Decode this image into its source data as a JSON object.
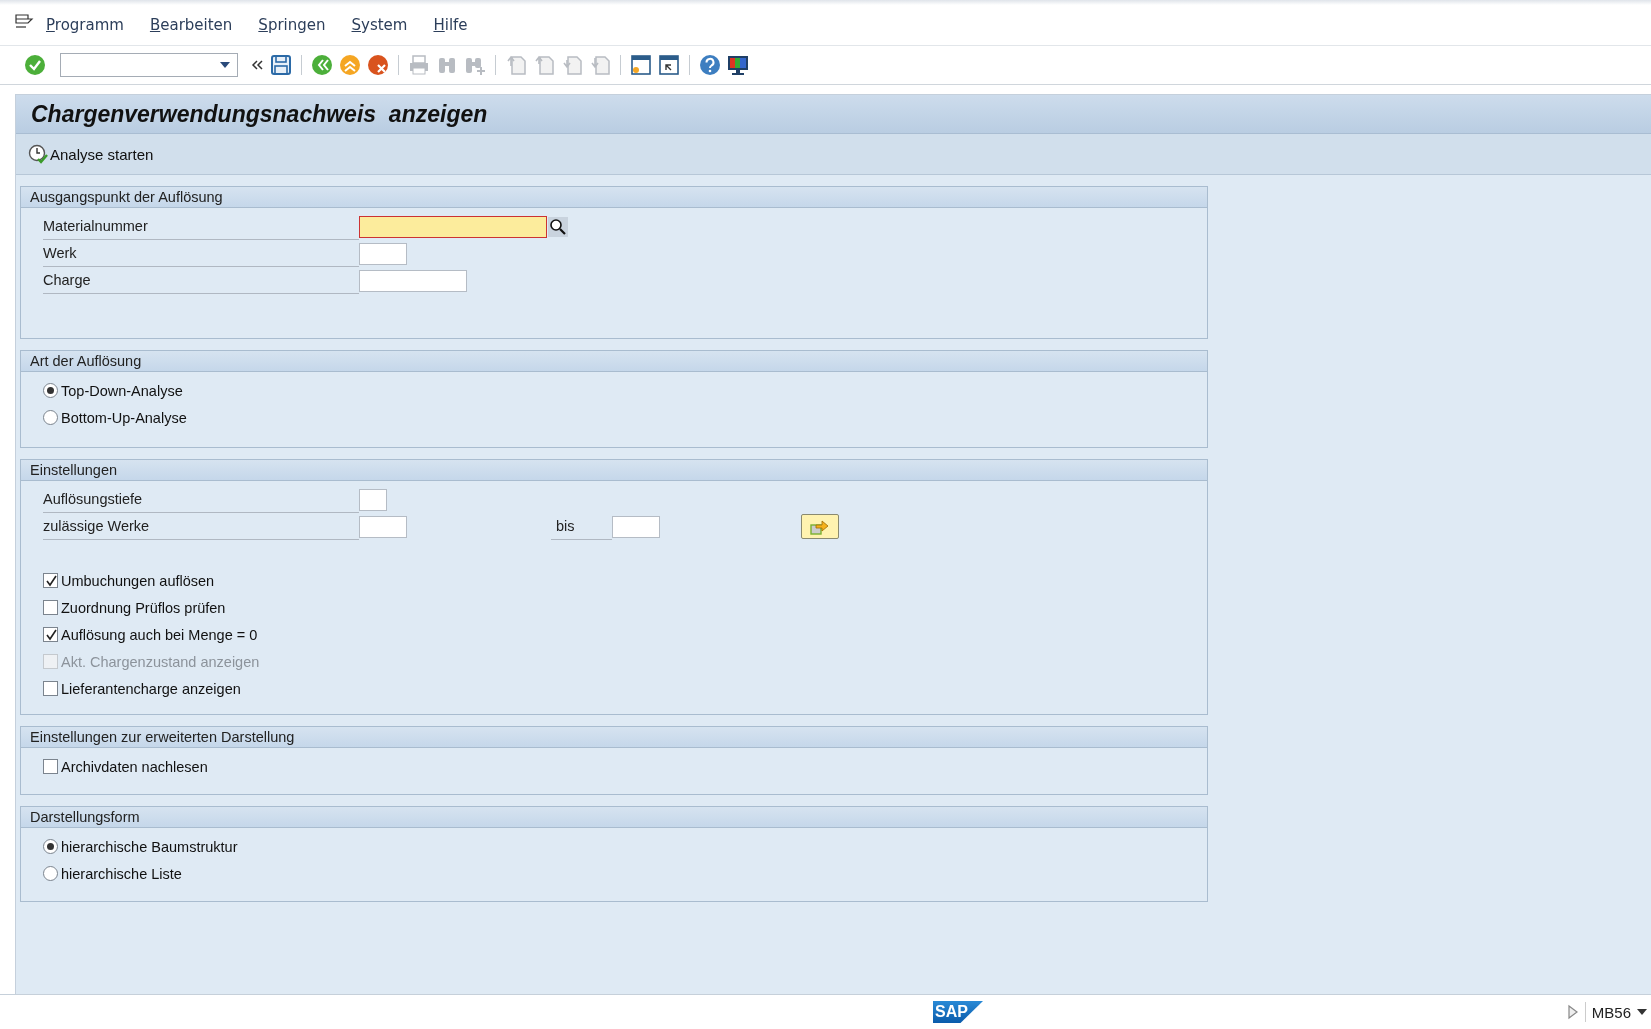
{
  "menu": [
    "Programm",
    "Bearbeiten",
    "Springen",
    "System",
    "Hilfe"
  ],
  "title": "Chargenverwendungsnachweis  anzeigen",
  "application_toolbar": [
    {
      "label": "Analyse starten"
    }
  ],
  "groups": [
    {
      "title": "Ausgangspunkt der Auflösung",
      "rows": [
        {
          "kind": "search_field",
          "label": "Materialnummer"
        },
        {
          "kind": "short_field",
          "label": "Werk"
        },
        {
          "kind": "medium_field",
          "label": "Charge"
        }
      ]
    },
    {
      "title": "Art der Auflösung",
      "rows": [
        {
          "kind": "radio",
          "label": "Top-Down-Analyse",
          "selected": true
        },
        {
          "kind": "radio",
          "label": "Bottom-Up-Analyse",
          "selected": false
        }
      ]
    },
    {
      "title": "Einstellungen",
      "rows": [
        {
          "kind": "tiny_field",
          "label": "Auflösungstiefe"
        },
        {
          "kind": "range",
          "label": "zulässige Werke",
          "to_label": "bis"
        },
        {
          "kind": "spacer"
        },
        {
          "kind": "checkbox",
          "label": "Umbuchungen auflösen",
          "checked": true,
          "disabled": false
        },
        {
          "kind": "checkbox",
          "label": "Zuordnung Prüflos prüfen",
          "checked": false,
          "disabled": false
        },
        {
          "kind": "checkbox",
          "label": "Auflösung auch bei Menge = 0",
          "checked": true,
          "disabled": false
        },
        {
          "kind": "checkbox",
          "label": "Akt. Chargenzustand anzeigen",
          "checked": false,
          "disabled": true
        },
        {
          "kind": "checkbox",
          "label": "Lieferantencharge anzeigen",
          "checked": false,
          "disabled": false
        }
      ]
    },
    {
      "title": "Einstellungen zur erweiterten Darstellung",
      "rows": [
        {
          "kind": "checkbox",
          "label": "Archivdaten nachlesen",
          "checked": false,
          "disabled": false
        }
      ]
    },
    {
      "title": "Darstellungsform",
      "rows": [
        {
          "kind": "radio",
          "label": "hierarchische Baumstruktur",
          "selected": true
        },
        {
          "kind": "radio",
          "label": "hierarchische Liste",
          "selected": false
        }
      ]
    }
  ],
  "status_bar": {
    "logo": "SAP",
    "transaction": "MB56"
  }
}
